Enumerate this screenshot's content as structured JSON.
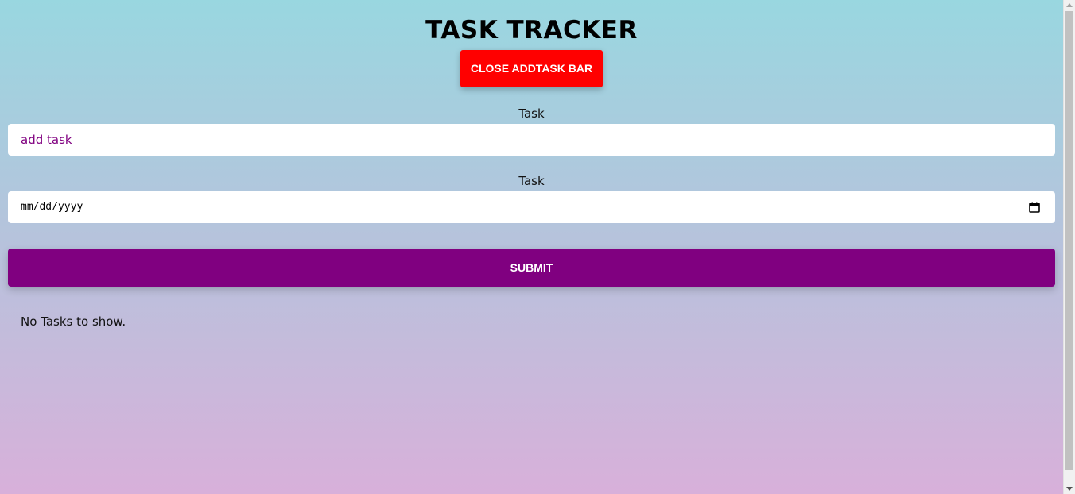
{
  "header": {
    "title": "TASK TRACKER",
    "toggle_button_label": "CLOSE ADDTASK BAR"
  },
  "form": {
    "task_label": "Task",
    "task_placeholder": "add task",
    "date_label": "Task",
    "date_placeholder": "mm/dd/yyyy",
    "submit_label": "SUBMIT"
  },
  "tasks": {
    "empty_message": "No Tasks to show."
  },
  "colors": {
    "toggle_button": "#ff0000",
    "submit_button": "#800080",
    "placeholder_text": "#800080",
    "background_top": "#99d7e0",
    "background_bottom": "#d8b0da"
  },
  "icons": {
    "date_picker": "calendar-icon"
  }
}
